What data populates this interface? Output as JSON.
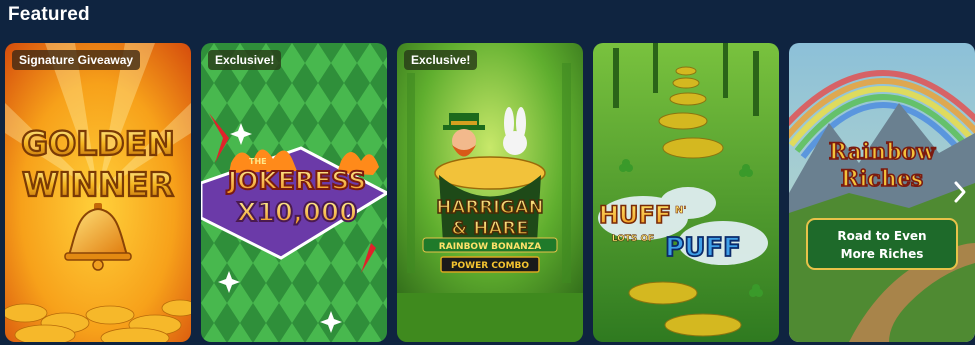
{
  "section": {
    "title": "Featured"
  },
  "games": [
    {
      "badge": "Signature Giveaway",
      "title_line1": "GOLDEN",
      "title_line2": "WINNER",
      "icon": "bell-icon"
    },
    {
      "badge": "Exclusive!",
      "title_small": "THE",
      "title_line1": "JOKERESS",
      "title_line2": "X10,000"
    },
    {
      "badge": "Exclusive!",
      "title_line1": "HARRIGAN",
      "title_line2": "& HARE",
      "subtitle": "RAINBOW BONANZA",
      "tag": "POWER COMBO"
    },
    {
      "title_line1": "HUFF",
      "title_small": "N'",
      "title_line2": "LOTS OF",
      "title_line3": "PUFF"
    },
    {
      "title_line1": "Rainbow",
      "title_line2": "Riches",
      "subtitle_line1": "Road to Even",
      "subtitle_line2": "More Riches"
    }
  ],
  "colors": {
    "page_bg": "#0f2440",
    "badge_bg": "#3c2814"
  },
  "icons": {
    "next": "chevron-right-icon"
  }
}
